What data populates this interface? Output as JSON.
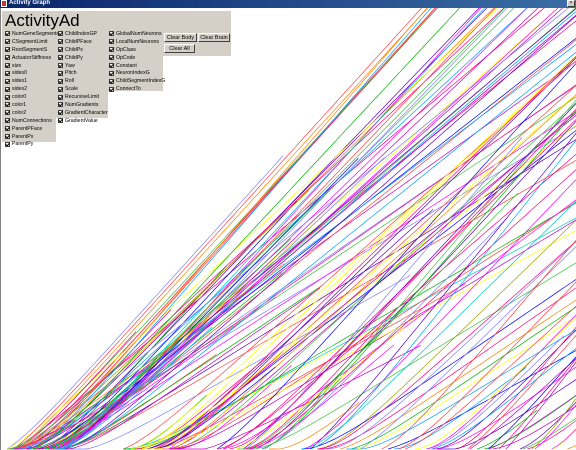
{
  "window": {
    "title": "Activity Graph"
  },
  "panel": {
    "title": "ActivityAd"
  },
  "checkboxes": {
    "col1": [
      "NumGeneSegments",
      "CSegmentLimit",
      "RootSegmentS",
      "ActuatorStiffness",
      "size",
      "sides0",
      "sides1",
      "sides2",
      "color0",
      "color1",
      "color2",
      "NumConnections",
      "ParentPFace",
      "ParentPx",
      "ParentPy"
    ],
    "col2": [
      "ChildIndexGP",
      "ChildPFace",
      "ChildPx",
      "ChildPy",
      "Yaw",
      "Pitch",
      "Roll",
      "Scale",
      "RecursiveLimit",
      "NumGradients",
      "GradientCharacter",
      "GradientValue"
    ],
    "col3": [
      "GlobalNumNeurons",
      "LocalNumNeurons",
      "OpClass",
      "OpCode",
      "Constant",
      "NeuronIndexG",
      "ChildSegmentIndexG",
      "ConnectTo"
    ]
  },
  "buttons": {
    "clear_body": "Clear Body",
    "clear_brain": "Clear Brain",
    "clear_all": "Clear All"
  },
  "colors": {
    "window_bg": "#d4d0c8",
    "title_bar": "#0a246a",
    "plot_bg": "#ffffff"
  }
}
